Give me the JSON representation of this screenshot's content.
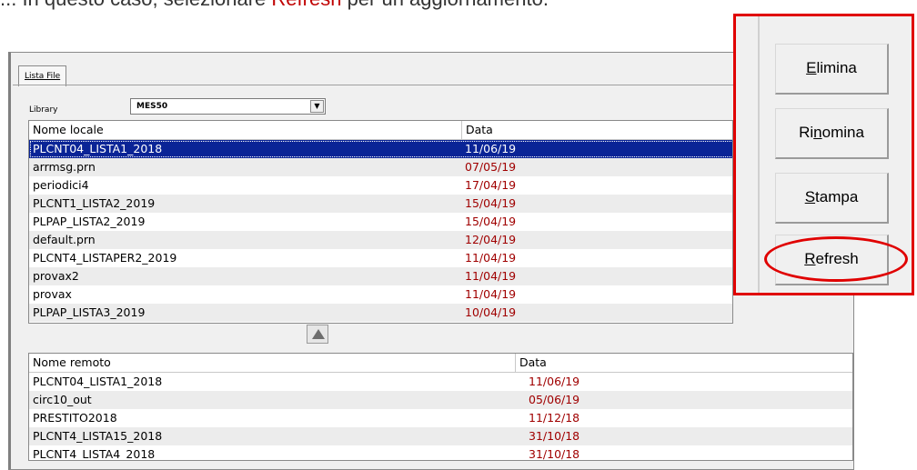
{
  "caption": {
    "before": "... In questo caso, selezionare ",
    "highlight": "Refresh",
    "after": " per un aggiornamento."
  },
  "tab": {
    "label": "Lista File"
  },
  "library": {
    "label": "Library",
    "value": "MES50"
  },
  "local_list": {
    "headers": {
      "name": "Nome locale",
      "date": "Data"
    },
    "rows": [
      {
        "name": "PLCNT04_LISTA1_2018",
        "date": "11/06/19",
        "selected": true
      },
      {
        "name": "arrmsg.prn",
        "date": "07/05/19"
      },
      {
        "name": "periodici4",
        "date": "17/04/19"
      },
      {
        "name": "PLCNT1_LISTA2_2019",
        "date": "15/04/19"
      },
      {
        "name": "PLPAP_LISTA2_2019",
        "date": "15/04/19"
      },
      {
        "name": "default.prn",
        "date": "12/04/19"
      },
      {
        "name": "PLCNT4_LISTAPER2_2019",
        "date": "11/04/19"
      },
      {
        "name": "provax2",
        "date": "11/04/19"
      },
      {
        "name": "provax",
        "date": "11/04/19"
      },
      {
        "name": "PLPAP_LISTA3_2019",
        "date": "10/04/19"
      }
    ]
  },
  "remote_list": {
    "headers": {
      "name": "Nome remoto",
      "date": "Data"
    },
    "rows": [
      {
        "name": "PLCNT04_LISTA1_2018",
        "date": "11/06/19"
      },
      {
        "name": "circ10_out",
        "date": "05/06/19"
      },
      {
        "name": "PRESTITO2018",
        "date": "11/12/18"
      },
      {
        "name": "PLCNT4_LISTA15_2018",
        "date": "31/10/18"
      },
      {
        "name": "PLCNT4_LISTA4_2018",
        "date": "31/10/18"
      }
    ]
  },
  "buttons": {
    "elimina": {
      "u": "E",
      "rest": "limina"
    },
    "rinomina": {
      "pre": "Ri",
      "u": "n",
      "rest": "omina"
    },
    "stampa": {
      "u": "S",
      "rest": "tampa"
    },
    "refresh": {
      "u": "R",
      "rest": "efresh"
    }
  },
  "colors": {
    "highlight_red": "#e00000",
    "selection": "#0a2496",
    "date_text": "#a00000"
  }
}
